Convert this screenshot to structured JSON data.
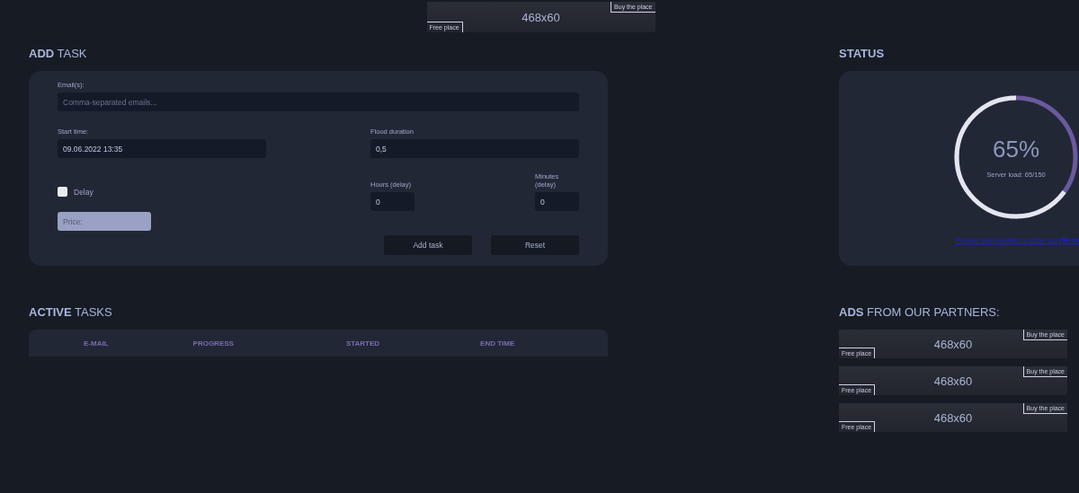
{
  "top_ad": {
    "size": "468x60",
    "free_label": "Free place",
    "buy_label": "Buy the place"
  },
  "add_task": {
    "title": "**ADD** TASK",
    "emails": {
      "label": "Email(s):",
      "placeholder": "Comma-separated emails..."
    },
    "start_time": {
      "label": "Start time:",
      "value": "09.06.2022 13:35"
    },
    "flood_duration": {
      "label": "Flood duration",
      "value": "0,5"
    },
    "delay": {
      "label": "Delay",
      "checked": false
    },
    "hours_delay": {
      "label": "Hours (delay)",
      "value": "0"
    },
    "minutes_delay": {
      "label": "Minutes (delay)",
      "value": "0"
    },
    "price": {
      "placeholder": "Price:"
    },
    "buttons": [
      "Add task",
      "Reset"
    ]
  },
  "status": {
    "title": "STATUS",
    "percent": "65%",
    "level": 0.65,
    "caption": "Server load: 65/150",
    "link": "Popular mail providers's inbox test **(90 mi**"
  },
  "active_tasks": {
    "title": "**ACTIVE** TASKS",
    "columns": [
      "E-MAIL",
      "PROGRESS",
      "STARTED",
      "END TIME"
    ]
  },
  "ads": {
    "title": "**ADS** FROM OUR PARTNERS:",
    "items": [
      {
        "size": "468x60",
        "free_label": "Free place",
        "buy_label": "Buy the place"
      },
      {
        "size": "468x60",
        "free_label": "Free place",
        "buy_label": "Buy the place"
      },
      {
        "size": "468x60",
        "free_label": "Free place",
        "buy_label": "Buy the place"
      }
    ]
  }
}
